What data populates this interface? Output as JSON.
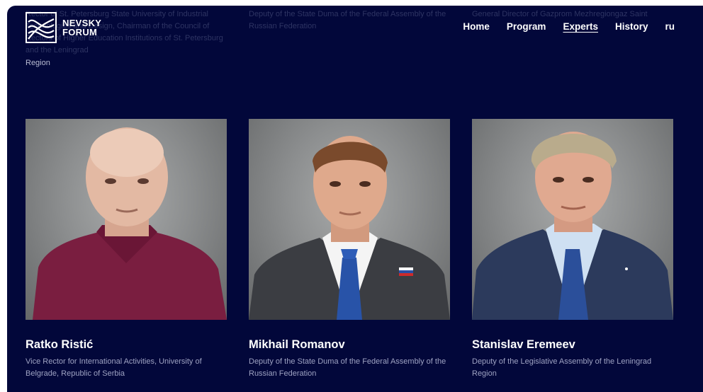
{
  "header": {
    "logo_line1": "NEVSKY",
    "logo_line2": "FORUM",
    "nav": [
      {
        "label": "Home"
      },
      {
        "label": "Program"
      },
      {
        "label": "Experts",
        "active": true
      },
      {
        "label": "History"
      },
      {
        "label": "ru"
      }
    ]
  },
  "previous_row": [
    {
      "text": "Rector of St. Petersburg State University of Industrial Technologies and Design, Chairman of the Council of Rectors of Higher Education Institutions of St. Petersburg and the Leningrad",
      "last_line": "Region"
    },
    {
      "text": "Deputy of the State Duma of the Federal Assembly of the Russian Federation"
    },
    {
      "text": "General Director of Gazprom Mezhregiongaz Saint"
    }
  ],
  "experts": [
    {
      "name": "Ratko Ristić",
      "role": "Vice Rector for International Activities, University of Belgrade, Republic of Serbia"
    },
    {
      "name": "Mikhail Romanov",
      "role": "Deputy of the State Duma of the Federal Assembly of the Russian Federation"
    },
    {
      "name": "Stanislav Eremeev",
      "role": "Deputy of the Legislative Assembly of the Leningrad Region"
    }
  ],
  "colors": {
    "background": "#02073a",
    "text": "#ffffff",
    "muted": "#9ea2c2"
  }
}
